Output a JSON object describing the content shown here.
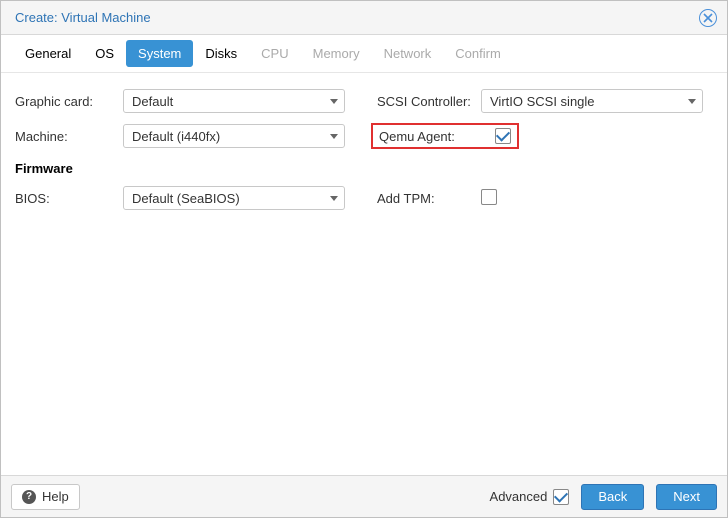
{
  "window": {
    "title": "Create: Virtual Machine"
  },
  "tabs": [
    {
      "label": "General",
      "state": "enabled"
    },
    {
      "label": "OS",
      "state": "enabled"
    },
    {
      "label": "System",
      "state": "active"
    },
    {
      "label": "Disks",
      "state": "enabled"
    },
    {
      "label": "CPU",
      "state": "disabled"
    },
    {
      "label": "Memory",
      "state": "disabled"
    },
    {
      "label": "Network",
      "state": "disabled"
    },
    {
      "label": "Confirm",
      "state": "disabled"
    }
  ],
  "form": {
    "graphic_card": {
      "label": "Graphic card:",
      "value": "Default"
    },
    "machine": {
      "label": "Machine:",
      "value": "Default (i440fx)"
    },
    "firmware_section": "Firmware",
    "bios": {
      "label": "BIOS:",
      "value": "Default (SeaBIOS)"
    },
    "scsi_controller": {
      "label": "SCSI Controller:",
      "value": "VirtIO SCSI single"
    },
    "qemu_agent": {
      "label": "Qemu Agent:",
      "checked": true
    },
    "add_tpm": {
      "label": "Add TPM:",
      "checked": false
    }
  },
  "footer": {
    "help": "Help",
    "advanced": {
      "label": "Advanced",
      "checked": true
    },
    "back": "Back",
    "next": "Next"
  }
}
